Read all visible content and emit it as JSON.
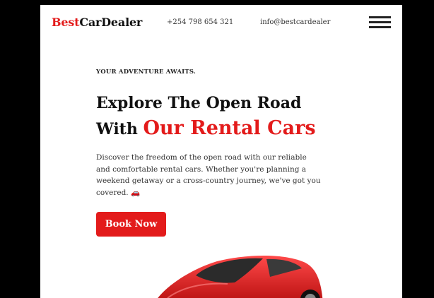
{
  "header": {
    "logo_part1": "Best",
    "logo_part2": "CarDealer",
    "phone": "+254 798 654 321",
    "email": "info@bestcardealer"
  },
  "hero": {
    "eyebrow": "YOUR ADVENTURE AWAITS.",
    "headline_line1": "Explore The Open Road",
    "headline_line2_prefix": "With",
    "headline_line2_accent": "Our Rental Cars",
    "description": "Discover the freedom of the open road with our reliable and comfortable rental cars. Whether you're planning a weekend getaway or a cross-country journey, we've got you covered. 🚗",
    "cta_label": "Book Now"
  },
  "colors": {
    "accent": "#e31b1b",
    "text_dark": "#111111",
    "background": "#ffffff",
    "frame": "#000000"
  },
  "icons": {
    "menu": "hamburger-menu-icon",
    "car_image": "red-sports-car-image"
  }
}
